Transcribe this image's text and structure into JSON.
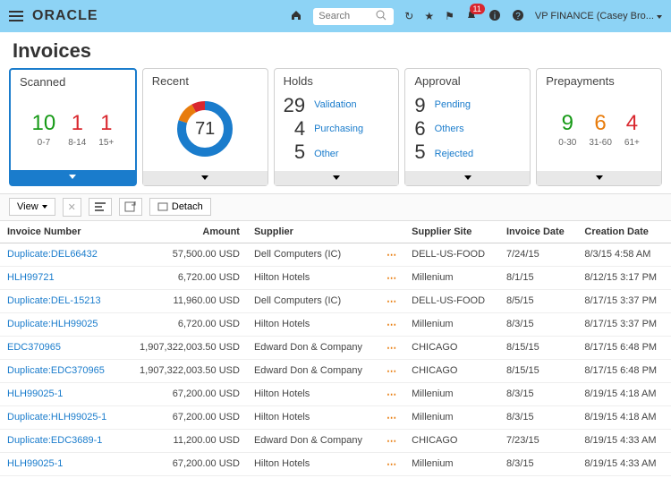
{
  "header": {
    "brand": "ORACLE",
    "search_placeholder": "Search",
    "notification_count": "11",
    "user_label": "VP FINANCE (Casey Bro..."
  },
  "page_title": "Invoices",
  "cards": {
    "scanned": {
      "title": "Scanned",
      "items": [
        {
          "value": "10",
          "sub": "0-7",
          "color": "c-green"
        },
        {
          "value": "1",
          "sub": "8-14",
          "color": "c-red"
        },
        {
          "value": "1",
          "sub": "15+",
          "color": "c-red"
        }
      ]
    },
    "recent": {
      "title": "Recent",
      "center": "71",
      "slices": [
        {
          "color": "#1a7ccc",
          "pct": 80
        },
        {
          "color": "#e87c0c",
          "pct": 12
        },
        {
          "color": "#d9272e",
          "pct": 8
        }
      ]
    },
    "holds": {
      "title": "Holds",
      "rows": [
        {
          "value": "29",
          "label": "Validation"
        },
        {
          "value": "4",
          "label": "Purchasing"
        },
        {
          "value": "5",
          "label": "Other"
        }
      ]
    },
    "approval": {
      "title": "Approval",
      "rows": [
        {
          "value": "9",
          "label": "Pending"
        },
        {
          "value": "6",
          "label": "Others"
        },
        {
          "value": "5",
          "label": "Rejected"
        }
      ]
    },
    "prepayments": {
      "title": "Prepayments",
      "items": [
        {
          "value": "9",
          "sub": "0-30",
          "color": "c-green"
        },
        {
          "value": "6",
          "sub": "31-60",
          "color": "c-orange"
        },
        {
          "value": "4",
          "sub": "61+",
          "color": "c-red"
        }
      ]
    }
  },
  "toolbar": {
    "view": "View",
    "detach": "Detach"
  },
  "table": {
    "columns": [
      "Invoice Number",
      "Amount",
      "Supplier",
      "",
      "Supplier Site",
      "Invoice Date",
      "Creation Date"
    ],
    "rows": [
      {
        "invoice": "Duplicate:DEL66432",
        "amount": "57,500.00 USD",
        "supplier": "Dell Computers (IC)",
        "site": "DELL-US-FOOD",
        "idate": "7/24/15",
        "cdate": "8/3/15 4:58 AM"
      },
      {
        "invoice": "HLH99721",
        "amount": "6,720.00 USD",
        "supplier": "Hilton Hotels",
        "site": "Millenium",
        "idate": "8/1/15",
        "cdate": "8/12/15 3:17 PM"
      },
      {
        "invoice": "Duplicate:DEL-15213",
        "amount": "11,960.00 USD",
        "supplier": "Dell Computers (IC)",
        "site": "DELL-US-FOOD",
        "idate": "8/5/15",
        "cdate": "8/17/15 3:37 PM"
      },
      {
        "invoice": "Duplicate:HLH99025",
        "amount": "6,720.00 USD",
        "supplier": "Hilton Hotels",
        "site": "Millenium",
        "idate": "8/3/15",
        "cdate": "8/17/15 3:37 PM"
      },
      {
        "invoice": "EDC370965",
        "amount": "1,907,322,003.50 USD",
        "supplier": "Edward Don & Company",
        "site": "CHICAGO",
        "idate": "8/15/15",
        "cdate": "8/17/15 6:48 PM"
      },
      {
        "invoice": "Duplicate:EDC370965",
        "amount": "1,907,322,003.50 USD",
        "supplier": "Edward Don & Company",
        "site": "CHICAGO",
        "idate": "8/15/15",
        "cdate": "8/17/15 6:48 PM"
      },
      {
        "invoice": "HLH99025-1",
        "amount": "67,200.00 USD",
        "supplier": "Hilton Hotels",
        "site": "Millenium",
        "idate": "8/3/15",
        "cdate": "8/19/15 4:18 AM"
      },
      {
        "invoice": "Duplicate:HLH99025-1",
        "amount": "67,200.00 USD",
        "supplier": "Hilton Hotels",
        "site": "Millenium",
        "idate": "8/3/15",
        "cdate": "8/19/15 4:18 AM"
      },
      {
        "invoice": "Duplicate:EDC3689-1",
        "amount": "11,200.00 USD",
        "supplier": "Edward Don & Company",
        "site": "CHICAGO",
        "idate": "7/23/15",
        "cdate": "8/19/15 4:33 AM"
      },
      {
        "invoice": "HLH99025-1",
        "amount": "67,200.00 USD",
        "supplier": "Hilton Hotels",
        "site": "Millenium",
        "idate": "8/3/15",
        "cdate": "8/19/15 4:33 AM"
      }
    ]
  }
}
